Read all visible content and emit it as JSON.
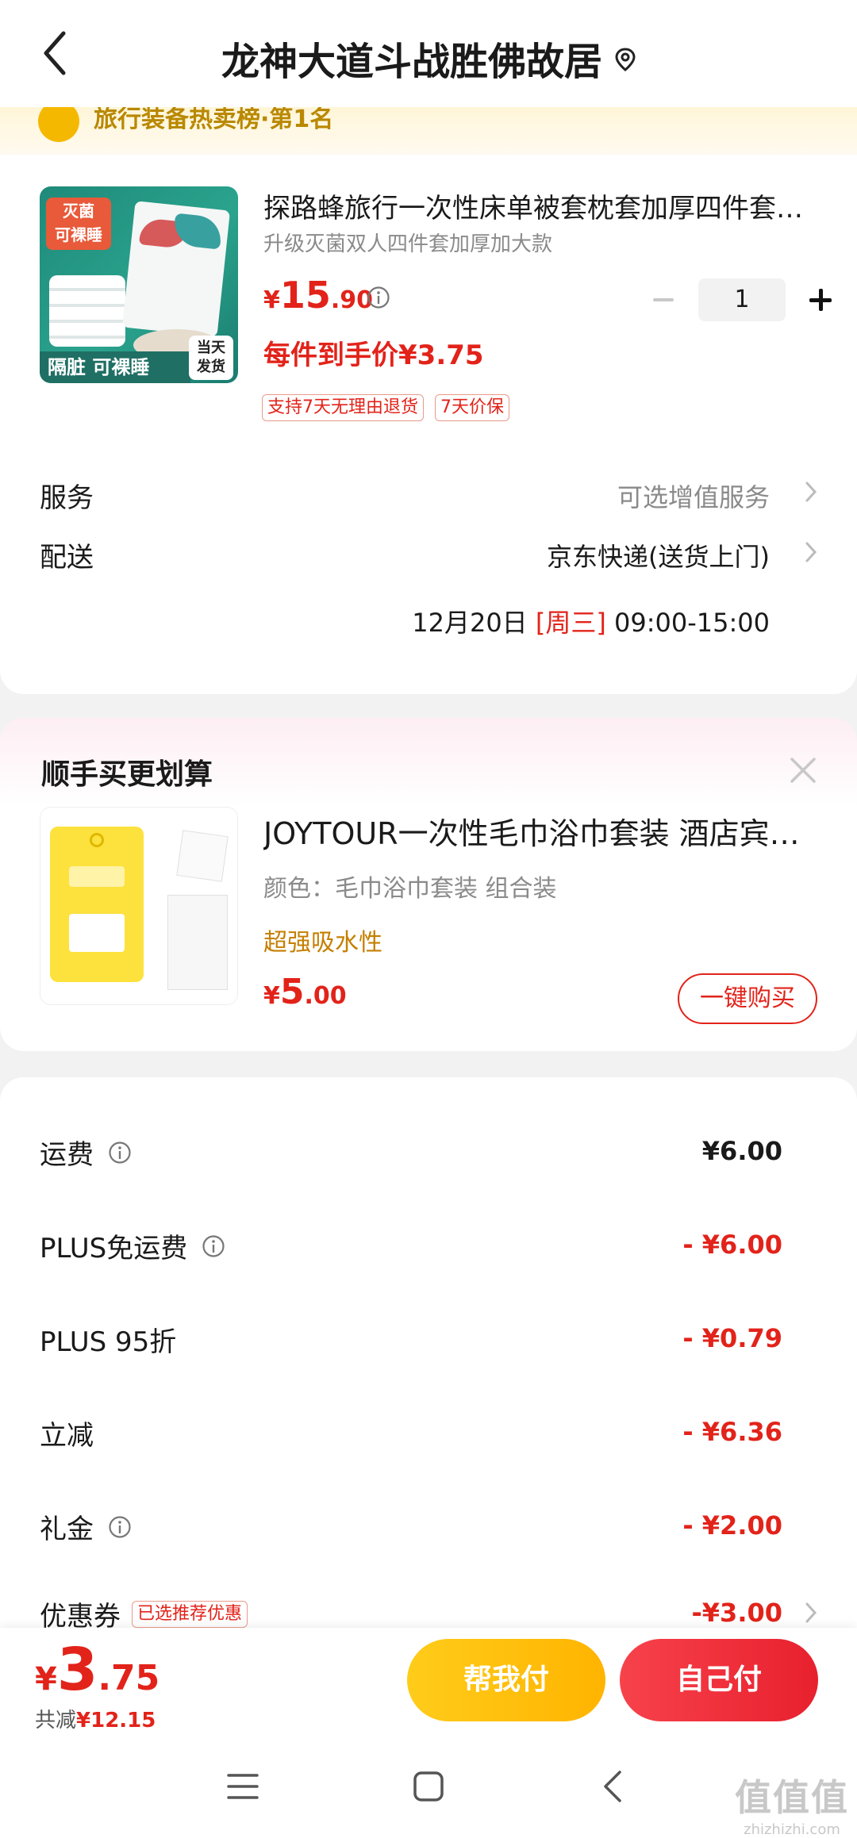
{
  "header": {
    "title": "龙神大道斗战胜佛故居"
  },
  "banner": {
    "text": "旅行装备热卖榜·第1名"
  },
  "product": {
    "image_badge": "灭菌\n可裸睡",
    "image_bottom": "隔脏 可裸睡",
    "image_day": "当天\n发货",
    "title": "探路蜂旅行一次性床单被套枕套加厚四件套酒店",
    "spec": "升级灭菌双人四件套加厚加大款",
    "price_symbol": "¥",
    "price_int": "15",
    "price_dec": ".90",
    "quantity": "1",
    "unit_price": "每件到手价¥3.75",
    "tags": [
      "支持7天无理由退货",
      "7天价保"
    ]
  },
  "service": {
    "label": "服务",
    "value": "可选增值服务"
  },
  "delivery": {
    "label": "配送",
    "value": "京东快递(送货上门)",
    "date": "12月20日 ",
    "weekday": "[周三]",
    "time": " 09:00-15:00"
  },
  "recommend": {
    "title": "顺手买更划算",
    "product_title": "JOYTOUR一次性毛巾浴巾套装 酒店宾馆旅行",
    "spec": "颜色：毛巾浴巾套装 组合装",
    "feature": "超强吸水性",
    "price_symbol": "¥",
    "price_int": "5",
    "price_dec": ".00",
    "buy_label": "一键购买"
  },
  "fees": [
    {
      "label": "运费",
      "info": true,
      "value": "¥6.00",
      "color": "black"
    },
    {
      "label": "PLUS免运费",
      "info": true,
      "value": "- ¥6.00",
      "color": "red"
    },
    {
      "label": "PLUS 95折",
      "info": false,
      "value": "- ¥0.79",
      "color": "red"
    },
    {
      "label": "立减",
      "info": false,
      "value": "- ¥6.36",
      "color": "red"
    },
    {
      "label": "礼金",
      "info": true,
      "value": "- ¥2.00",
      "color": "red"
    }
  ],
  "coupon": {
    "label": "优惠券",
    "tag": "已选推荐优惠",
    "value": "-¥3.00"
  },
  "bottom": {
    "total_symbol": "¥",
    "total_int": "3",
    "total_dec": ".75",
    "saved_prefix": "共减",
    "saved_value": "¥12.15",
    "help_pay": "帮我付",
    "self_pay": "自己付"
  },
  "watermark": {
    "big": "值值值",
    "small": "zhizhizhi.com"
  },
  "colors": {
    "accent_red": "#e2231a",
    "gold": "#ffb400",
    "feature_orange": "#c57f00"
  }
}
